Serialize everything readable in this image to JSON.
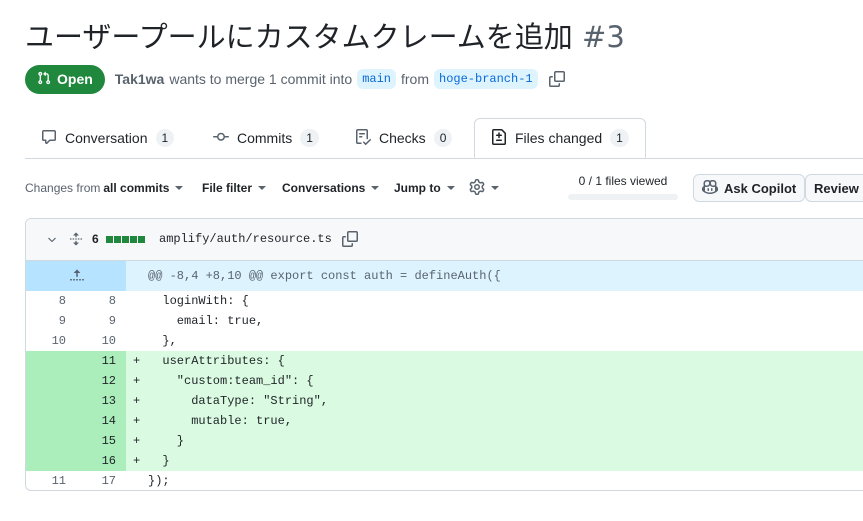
{
  "pr": {
    "title": "ユーザープールにカスタムクレームを追加",
    "number": "#3",
    "state": "Open",
    "author": "Tak1wa",
    "merge_text": "wants to merge 1 commit into",
    "base_branch": "main",
    "from_text": "from",
    "head_branch": "hoge-branch-1"
  },
  "tabs": [
    {
      "label": "Conversation",
      "count": "1",
      "icon": "comment-icon"
    },
    {
      "label": "Commits",
      "count": "1",
      "icon": "commit-icon"
    },
    {
      "label": "Checks",
      "count": "0",
      "icon": "checklist-icon"
    },
    {
      "label": "Files changed",
      "count": "1",
      "icon": "file-diff-icon"
    }
  ],
  "toolbar": {
    "changes_from_prefix": "Changes from",
    "changes_from_value": "all commits",
    "file_filter": "File filter",
    "conversations": "Conversations",
    "jump_to": "Jump to",
    "files_viewed": "0 / 1 files viewed",
    "files_viewed_fraction": 0,
    "ask_copilot": "Ask Copilot",
    "review": "Review in"
  },
  "file": {
    "changes": "6",
    "path": "amplify/auth/resource.ts",
    "hunk": "@@ -8,4 +8,10 @@ export const auth = defineAuth({"
  },
  "diff_lines": [
    {
      "old": "8",
      "new": "8",
      "sign": "",
      "type": "context",
      "text": "  loginWith: {"
    },
    {
      "old": "9",
      "new": "9",
      "sign": "",
      "type": "context",
      "text": "    email: true,"
    },
    {
      "old": "10",
      "new": "10",
      "sign": "",
      "type": "context",
      "text": "  },"
    },
    {
      "old": "",
      "new": "11",
      "sign": "+",
      "type": "add",
      "text": "  userAttributes: {"
    },
    {
      "old": "",
      "new": "12",
      "sign": "+",
      "type": "add",
      "text": "    \"custom:team_id\": {"
    },
    {
      "old": "",
      "new": "13",
      "sign": "+",
      "type": "add",
      "text": "      dataType: \"String\","
    },
    {
      "old": "",
      "new": "14",
      "sign": "+",
      "type": "add",
      "text": "      mutable: true,"
    },
    {
      "old": "",
      "new": "15",
      "sign": "+",
      "type": "add",
      "text": "    }"
    },
    {
      "old": "",
      "new": "16",
      "sign": "+",
      "type": "add",
      "text": "  }"
    },
    {
      "old": "11",
      "new": "17",
      "sign": "",
      "type": "context",
      "text": "});"
    }
  ],
  "colors": {
    "open_green": "#1f883d",
    "add_bg": "#dafbe1",
    "add_gutter": "#aceebb",
    "hunk_bg": "#ddf4ff",
    "link_blue": "#0969da"
  }
}
